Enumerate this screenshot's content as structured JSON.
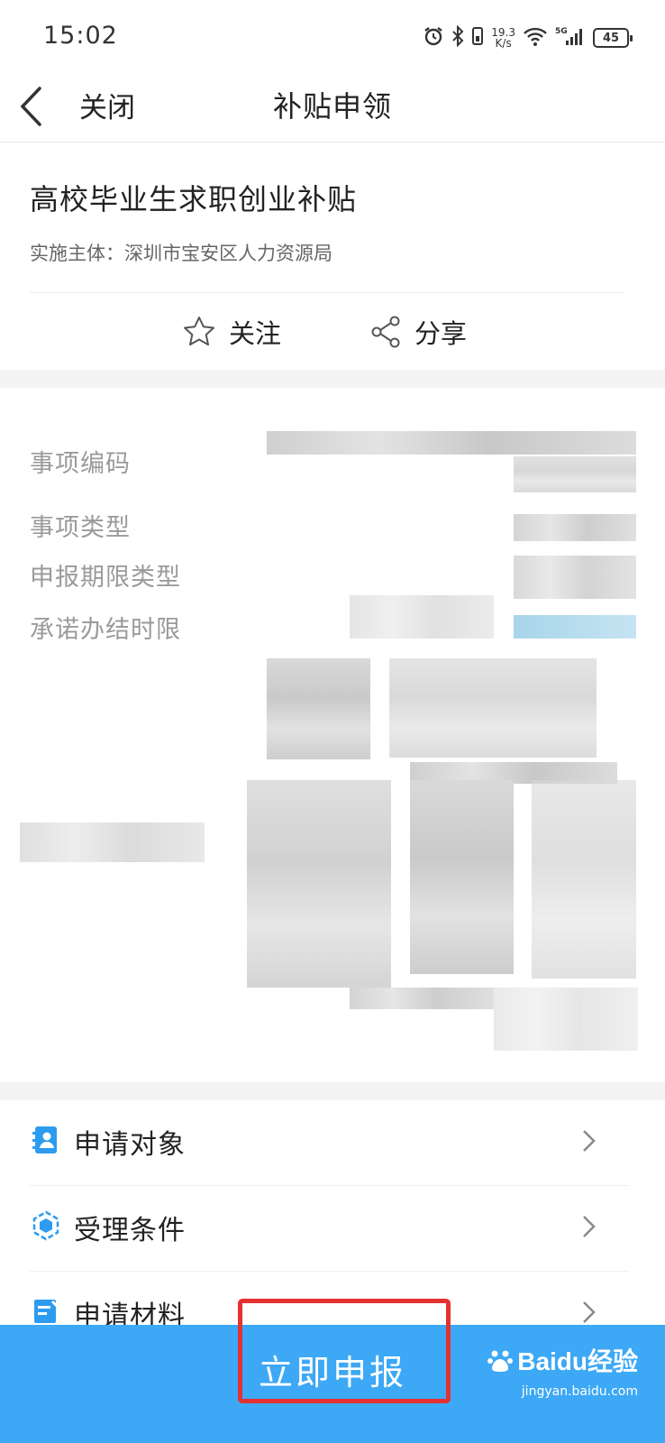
{
  "status_bar": {
    "time": "15:02",
    "net_speed_value": "19.3",
    "net_speed_unit": "K/s",
    "network_type": "5G",
    "battery": "45"
  },
  "nav": {
    "close_label": "关闭",
    "title": "补贴申领"
  },
  "header": {
    "title": "高校毕业生求职创业补贴",
    "subtitle": "实施主体：深圳市宝安区人力资源局",
    "follow_label": "关注",
    "share_label": "分享"
  },
  "info": {
    "labels": [
      "事项编码",
      "事项类型",
      "申报期限类型",
      "承诺办结时限"
    ]
  },
  "list": {
    "items": [
      {
        "label": "申请对象",
        "icon": "contact-book-icon"
      },
      {
        "label": "受理条件",
        "icon": "hexagon-cube-icon"
      },
      {
        "label": "申请材料",
        "icon": "document-edit-icon"
      }
    ]
  },
  "bottom": {
    "submit_label": "立即申报"
  },
  "watermark": {
    "brand": "Baidu经验",
    "url": "jingyan.baidu.com"
  },
  "colors": {
    "accent": "#3da8f5",
    "highlight_border": "#e43131",
    "icon_blue": "#2d9cf0"
  }
}
